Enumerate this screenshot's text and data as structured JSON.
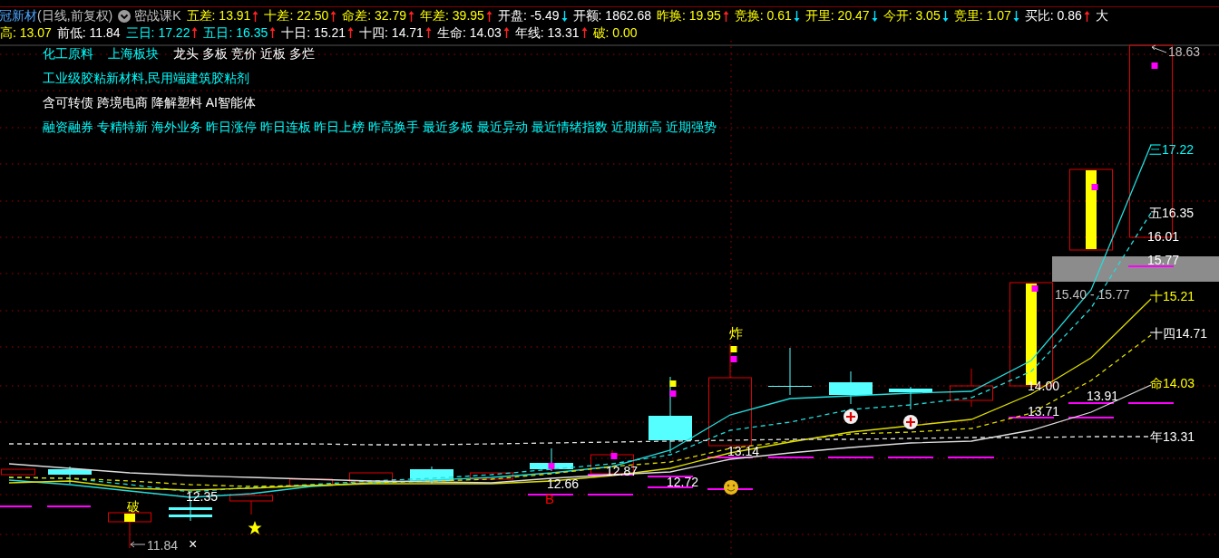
{
  "header": {
    "stock_name": "冠新材",
    "period": "(日线,前复权)",
    "indicator": "密战课K",
    "row_1": [
      {
        "label": "五差:",
        "value": "13.91",
        "rising": true,
        "color": "#ffff00"
      },
      {
        "label": "十差:",
        "value": "22.50",
        "rising": true,
        "color": "#ffff00"
      },
      {
        "label": "命差:",
        "value": "32.79",
        "rising": true,
        "color": "#ffff00"
      },
      {
        "label": "年差:",
        "value": "39.95",
        "rising": true,
        "color": "#ffff00"
      },
      {
        "label": "开盘:",
        "value": "-5.49",
        "rising": false,
        "color": "#ffffff"
      },
      {
        "label": "开额:",
        "value": "1862.68",
        "color": "#ffffff"
      },
      {
        "label": "昨换:",
        "value": "19.95",
        "rising": true,
        "color": "#ffff00"
      },
      {
        "label": "竞换:",
        "value": "0.61",
        "rising": false,
        "color": "#ffff00"
      },
      {
        "label": "开里:",
        "value": "20.47",
        "rising": false,
        "color": "#ffff00"
      },
      {
        "label": "今开:",
        "value": "3.05",
        "rising": false,
        "color": "#ffff00"
      },
      {
        "label": "竞里:",
        "value": "1.07",
        "rising": false,
        "color": "#ffff00"
      },
      {
        "label": "买比:",
        "value": "0.86",
        "rising": true,
        "color": "#ffffff"
      },
      {
        "label": "大",
        "color": "#ffffff"
      }
    ],
    "row_2": [
      {
        "label": "高:",
        "value": "13.07",
        "color": "#ffff00"
      },
      {
        "label": "前低:",
        "value": "11.84",
        "color": "#ffffff"
      },
      {
        "label": "三日:",
        "value": "17.22",
        "rising": true,
        "color": "#00ffff"
      },
      {
        "label": "五日:",
        "value": "16.35",
        "rising": true,
        "color": "#00ffff"
      },
      {
        "label": "十日:",
        "value": "15.21",
        "rising": true,
        "color": "#ffffff"
      },
      {
        "label": "十四:",
        "value": "14.71",
        "rising": true,
        "color": "#ffffff"
      },
      {
        "label": "生命:",
        "value": "14.03",
        "rising": true,
        "color": "#ffffff"
      },
      {
        "label": "年线:",
        "value": "13.31",
        "rising": true,
        "color": "#ffffff"
      },
      {
        "label": "破:",
        "value": "0.00",
        "color": "#ffff00"
      }
    ]
  },
  "tag_lines": [
    [
      {
        "text": "化工原料",
        "color": "#00ffff"
      },
      {
        "text": "上海板块",
        "color": "#00ffff"
      },
      {
        "text": "龙头 多板 竞价 近板 多烂",
        "color": "#ffffff"
      }
    ],
    [
      {
        "text": "工业级胶粘新材料,民用端建筑胶粘剂",
        "color": "#00ffff"
      }
    ],
    [
      {
        "text": "含可转债 跨境电商 降解塑料 AI智能体",
        "color": "#ffffff"
      }
    ],
    [
      {
        "text": "融资融券 专精特新 海外业务 昨日涨停 昨日连板 昨日上榜 昨高换手 最近多板 最近异动 最近情绪指数 近期新高 近期强势",
        "color": "#00ffff"
      }
    ]
  ],
  "chart_labels": [
    {
      "text": "18.63",
      "color": "#c0c0c0"
    },
    {
      "text": "三17.22",
      "color": "#00ffff"
    },
    {
      "text": "五16.35",
      "color": "#ffffff"
    },
    {
      "text": "16.01",
      "color": "#ffffff"
    },
    {
      "text": "15.77",
      "color": "#ffffff"
    },
    {
      "text": "15.40 - 15.77",
      "color": "#c0c0c0"
    },
    {
      "text": "十15.21",
      "color": "#ffff00"
    },
    {
      "text": "十四14.71",
      "color": "#ffffff"
    },
    {
      "text": "命14.03",
      "color": "#ffff00"
    },
    {
      "text": "14.00",
      "color": "#ffffff"
    },
    {
      "text": "13.91",
      "color": "#ffffff"
    },
    {
      "text": "13.71",
      "color": "#ffffff"
    },
    {
      "text": "年13.31",
      "color": "#ffffff"
    },
    {
      "text": "13.14",
      "color": "#ffffff"
    },
    {
      "text": "12.87",
      "color": "#ffffff"
    },
    {
      "text": "12.72",
      "color": "#ffffff"
    },
    {
      "text": "12.66",
      "color": "#ffffff"
    },
    {
      "text": "12.35",
      "color": "#ffffff"
    },
    {
      "text": "B",
      "color": "#ff0000"
    },
    {
      "text": "炸",
      "color": "#ffff00"
    },
    {
      "text": "破",
      "color": "#ffff00"
    },
    {
      "text": "11.84",
      "color": "#c0c0c0"
    },
    {
      "text": "×",
      "color": "#ffffff"
    }
  ]
}
